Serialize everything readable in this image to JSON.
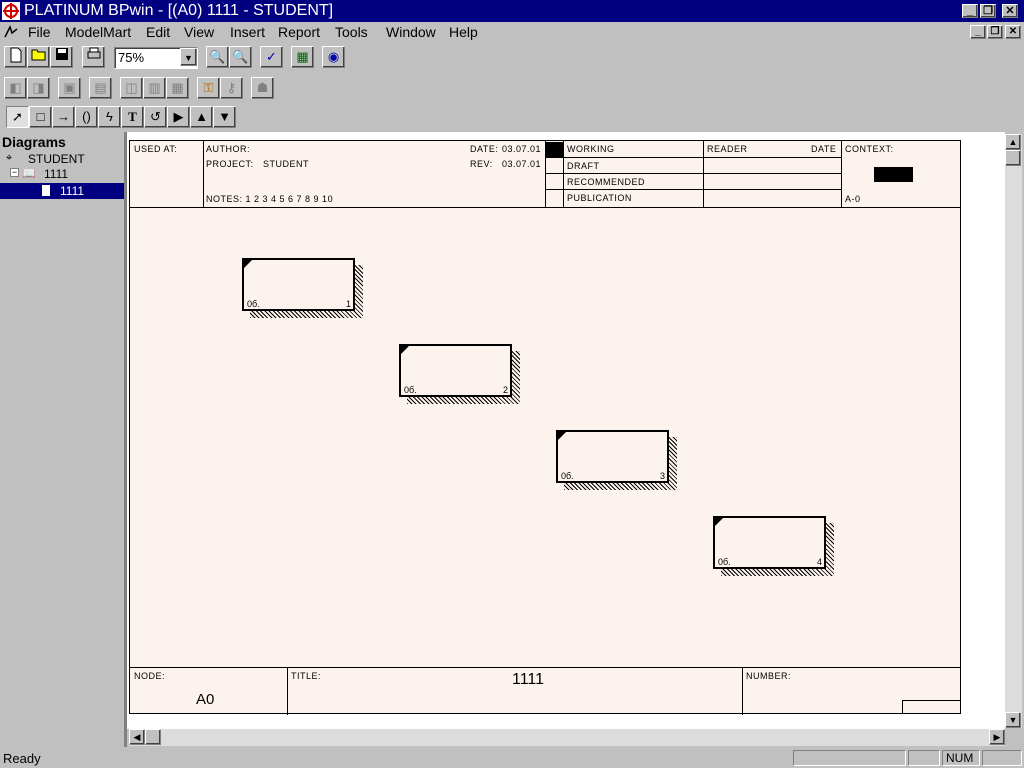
{
  "window": {
    "title": "PLATINUM BPwin - [(A0) 1111 - STUDENT]"
  },
  "menu": [
    "File",
    "ModelMart",
    "Edit",
    "View",
    "Insert",
    "Report",
    "Tools",
    "Window",
    "Help"
  ],
  "toolbar": {
    "zoom": "75%"
  },
  "tree": {
    "header": "Diagrams",
    "root": "STUDENT",
    "child": "1111",
    "leaf": "1111"
  },
  "diagram": {
    "used_at": "USED AT:",
    "author": "AUTHOR:",
    "project_label": "PROJECT:",
    "project": "STUDENT",
    "date_label": "DATE:",
    "date": "03.07.01",
    "rev_label": "REV:",
    "rev": "03.07.01",
    "notes": "NOTES:  1  2  3  4  5  6  7  8  9  10",
    "status": [
      "WORKING",
      "DRAFT",
      "RECOMMENDED",
      "PUBLICATION"
    ],
    "reader": "READER",
    "reader_date": "DATE",
    "context": "CONTEXT:",
    "context_node": "A-0",
    "node_label": "NODE:",
    "node": "A0",
    "title_label": "TITLE:",
    "title": "1111",
    "number_label": "NUMBER:",
    "boxes": [
      {
        "label": "0б.",
        "num": "1"
      },
      {
        "label": "0б.",
        "num": "2"
      },
      {
        "label": "0б.",
        "num": "3"
      },
      {
        "label": "0б.",
        "num": "4"
      }
    ]
  },
  "statusbar": {
    "text": "Ready",
    "num": "NUM"
  }
}
